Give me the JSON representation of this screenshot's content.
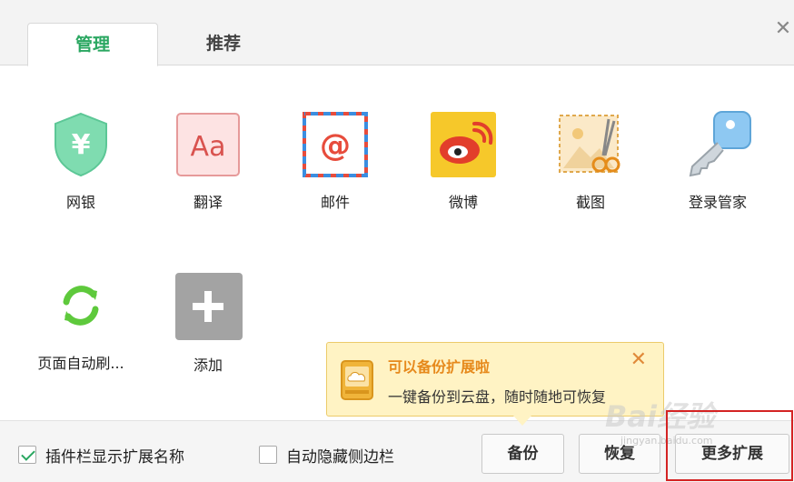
{
  "tabs": [
    {
      "label": "管理",
      "active": true
    },
    {
      "label": "推荐",
      "active": false
    }
  ],
  "extensions": [
    {
      "name": "网银",
      "icon": "shield-yuan-icon"
    },
    {
      "name": "翻译",
      "icon": "translate-aa-icon"
    },
    {
      "name": "邮件",
      "icon": "mail-envelope-icon"
    },
    {
      "name": "微博",
      "icon": "weibo-icon"
    },
    {
      "name": "截图",
      "icon": "screenshot-scissors-icon"
    },
    {
      "name": "登录管家",
      "icon": "key-icon"
    },
    {
      "name": "页面自动刷...",
      "icon": "refresh-icon"
    },
    {
      "name": "添加",
      "icon": "plus-icon"
    }
  ],
  "tooltip": {
    "title": "可以备份扩展啦",
    "body": "一键备份到云盘，随时随地可恢复",
    "icon": "cloud-disk-icon"
  },
  "footer": {
    "show_names": {
      "label": "插件栏显示扩展名称",
      "checked": true
    },
    "auto_hide": {
      "label": "自动隐藏侧边栏",
      "checked": false
    },
    "backup_label": "备份",
    "restore_label": "恢复",
    "more_label": "更多扩展"
  },
  "watermark": {
    "text": "Bai经验",
    "sub": "jingyan.baidu.com"
  },
  "colors": {
    "accent": "#2aa761",
    "tooltip_bg": "#fff3c4",
    "highlight": "#d42323"
  }
}
